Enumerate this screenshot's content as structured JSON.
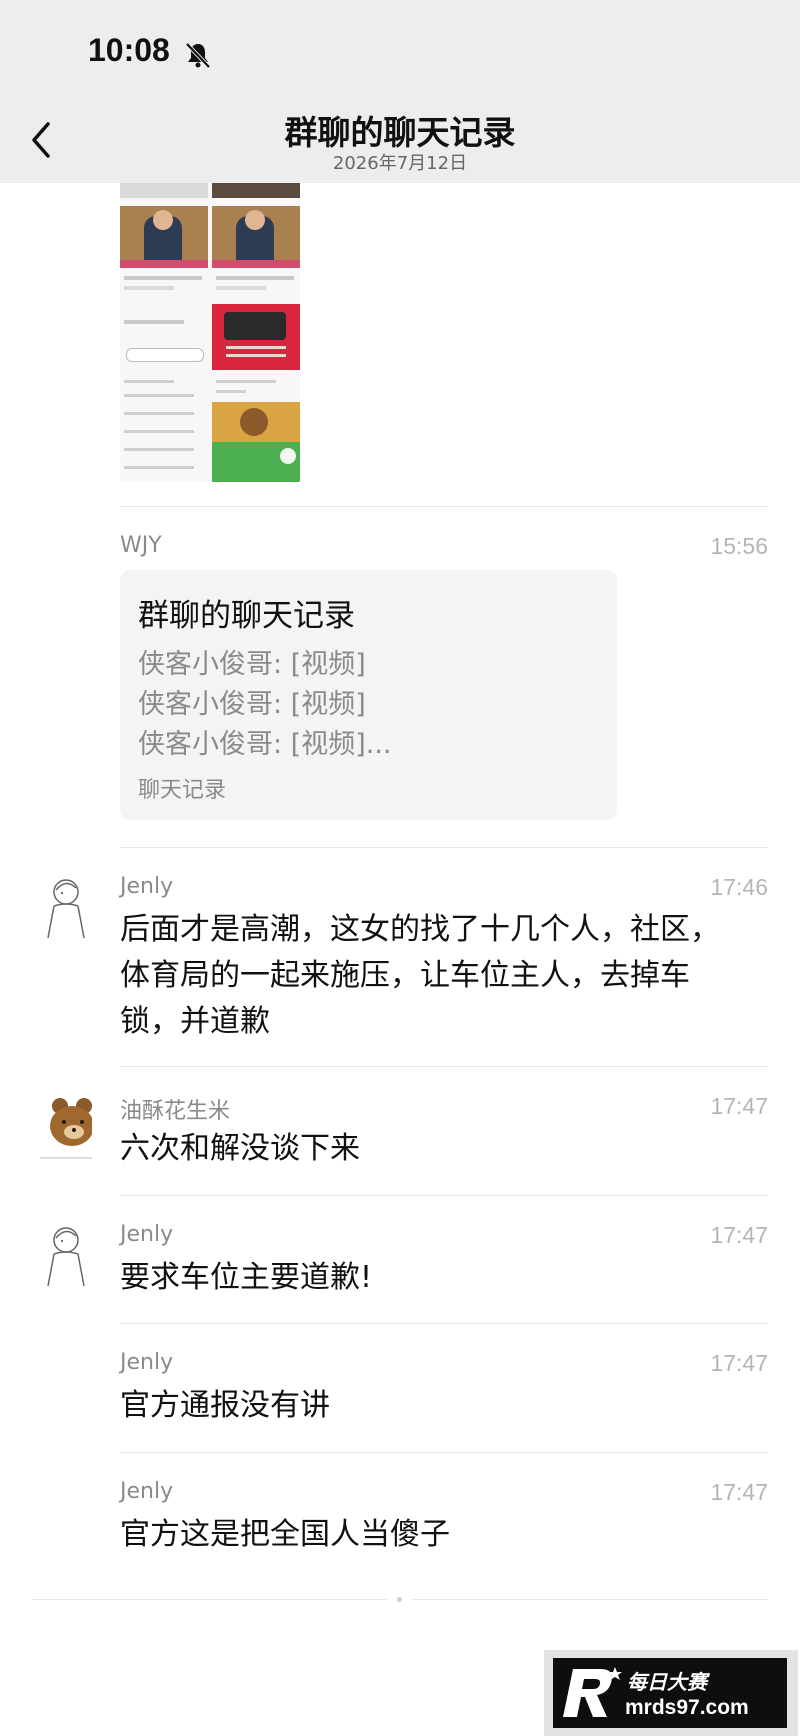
{
  "status_bar": {
    "time": "10:08"
  },
  "header": {
    "title": "群聊的聊天记录",
    "date": "2026年7月12日"
  },
  "messages": [
    {
      "sender": "WJY",
      "time": "15:56",
      "card": {
        "title": "群聊的聊天记录",
        "lines": [
          "侠客小俊哥: [视频]",
          "侠客小俊哥: [视频]",
          "侠客小俊哥: [视频]..."
        ],
        "footer": "聊天记录"
      }
    },
    {
      "sender": "Jenly",
      "time": "17:46",
      "lines": [
        "后面才是高潮，这女的找了十几个人，社区，",
        "体育局的一起来施压，让车位主人，去掉车",
        "锁，并道歉"
      ]
    },
    {
      "sender": "油酥花生米",
      "time": "17:47",
      "text": "六次和解没谈下来"
    },
    {
      "sender": "Jenly",
      "time": "17:47",
      "text": "要求车位主要道歉!"
    },
    {
      "sender": "Jenly",
      "time": "17:47",
      "text": "官方通报没有讲"
    },
    {
      "sender": "Jenly",
      "time": "17:47",
      "text": "官方这是把全国人当傻子"
    }
  ],
  "watermark": {
    "brand": "每日大赛",
    "url": "mrds97.com"
  },
  "colors": {
    "header_bg": "#ededed",
    "card_bg": "#f4f4f4",
    "secondary_text": "#8a8a8a"
  }
}
